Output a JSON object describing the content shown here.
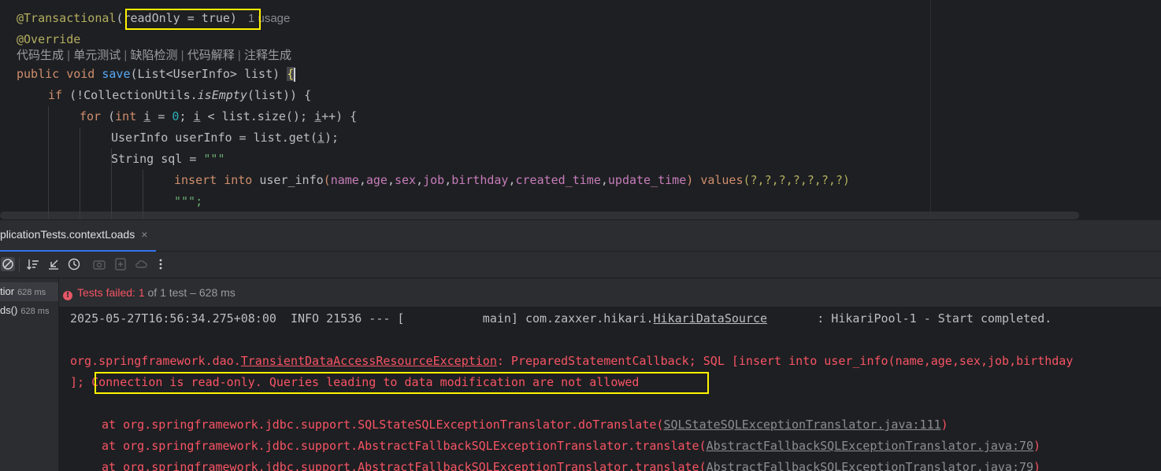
{
  "editor": {
    "annotation_name": "@Transactional",
    "annotation_args": "(readOnly = true)",
    "usage_hint": "1 usage",
    "override": "@Override",
    "lens_items": [
      "代码生成",
      "单元测试",
      "缺陷检测",
      "代码解释",
      "注释生成"
    ],
    "lens_separator": " | ",
    "line_save": {
      "kw1": "public",
      "kw2": "void",
      "method": "save",
      "sig": "(List<UserInfo> list) ",
      "brace": "{"
    },
    "line_if": {
      "kw": "if",
      "pre": " (!CollectionUtils.",
      "method": "isEmpty",
      "post": "(list)) {"
    },
    "line_for": {
      "kw": "for",
      "p1": " (",
      "kw2": "int",
      "p2": " ",
      "var1": "i",
      "p3": " = ",
      "zero": "0",
      "p4": "; ",
      "var2": "i",
      "p5": " < list.size(); ",
      "var3": "i",
      "p6": "++) {"
    },
    "line_userinfo": {
      "p1": "UserInfo userInfo = list.get(",
      "var": "i",
      "p2": ");"
    },
    "line_sql_decl": {
      "p1": "String sql = ",
      "str": "\"\"\""
    },
    "line_insert": {
      "kw1": "insert",
      "kw2": "into",
      "table": "user_info",
      "cols": [
        "name",
        "age",
        "sex",
        "job",
        "birthday",
        "created_time",
        "update_time"
      ],
      "kw3": "values",
      "params": "(?,?,?,?,?,?,?)"
    },
    "line_close_str": "\"\"\";"
  },
  "run": {
    "tab_title": "plicationTests.contextLoads",
    "tab_close": "×",
    "tree_items": [
      {
        "label": "tior",
        "time": "628 ms"
      },
      {
        "label": "ds()",
        "time": "628 ms"
      }
    ],
    "status": {
      "icon": "!",
      "failed_label": "Tests failed: 1",
      "rest": " of 1 test – 628 ms"
    },
    "console": {
      "log_line": {
        "prefix": "2025-05-27T16:56:34.275+08:00  INFO 21536 --- [           main] com.zaxxer.hikari.",
        "class_link": "HikariDataSource",
        "suffix": "       : HikariPool-1 - Start completed."
      },
      "exception_line": {
        "pkg": "org.springframework.dao.",
        "exc_link": "TransientDataAccessResourceException",
        "msg": ": PreparedStatementCallback; SQL [insert into user_info(name,age,sex,job,birthday"
      },
      "cause_line": {
        "prefix": "]; ",
        "message": "Connection is read-only. Queries leading to data modification are not allowed"
      },
      "stack": [
        {
          "at": "at org.springframework.jdbc.support.SQLStateSQLExceptionTranslator.doTranslate(",
          "link": "SQLStateSQLExceptionTranslator.java:111",
          "end": ")"
        },
        {
          "at": "at org.springframework.jdbc.support.AbstractFallbackSQLExceptionTranslator.translate(",
          "link": "AbstractFallbackSQLExceptionTranslator.java:70",
          "end": ")"
        },
        {
          "at": "at org.springframework.jdbc.support.AbstractFallbackSQLExceptionTranslator.translate(",
          "link": "AbstractFallbackSQLExceptionTranslator.java:79",
          "end": ")"
        }
      ]
    }
  }
}
